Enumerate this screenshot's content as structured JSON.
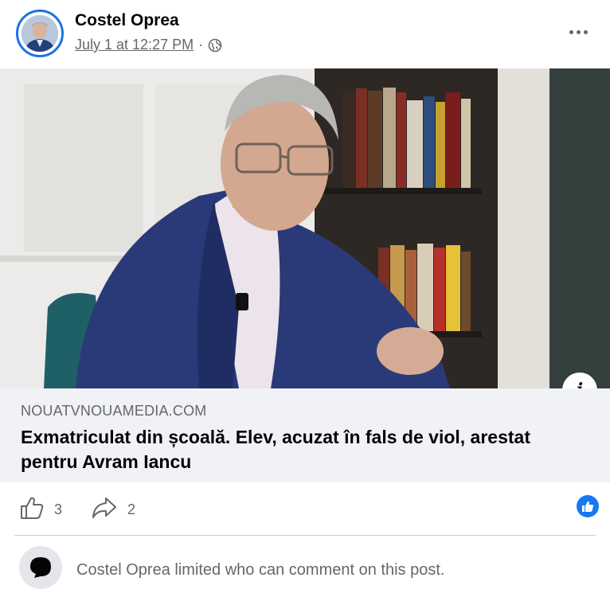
{
  "post": {
    "author": "Costel Oprea",
    "timestamp": "July 1 at 12:27 PM",
    "separator": "·",
    "audience_icon": "globe-icon",
    "more_icon": "more-options-icon"
  },
  "link_preview": {
    "domain": "NOUATVNOUAMEDIA.COM",
    "headline": "Exmatriculat din școală. Elev, acuzat în fals de viol, arestat pentru Avram Iancu",
    "info_icon": "i"
  },
  "actions": {
    "like_count": "3",
    "share_count": "2",
    "reaction_icon": "like-reaction-icon"
  },
  "comment_notice": {
    "text": "Costel Oprea limited who can comment on this post."
  },
  "colors": {
    "accent": "#1877f2",
    "secondary_text": "#65676b",
    "link_background": "#f0f2f5"
  }
}
